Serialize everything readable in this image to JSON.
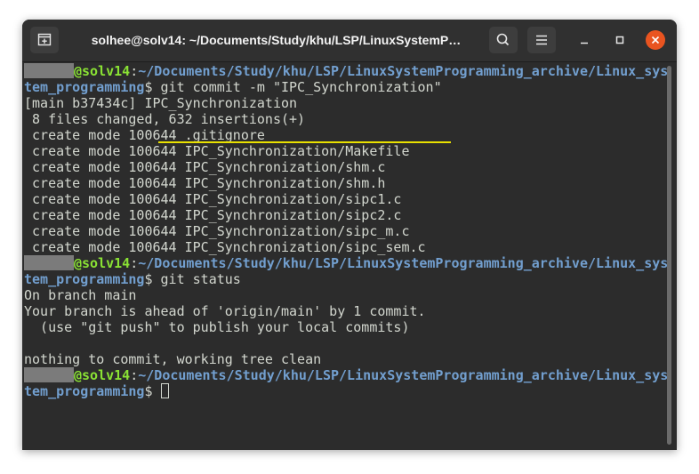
{
  "window": {
    "title": "solhee@solv14: ~/Documents/Study/khu/LSP/LinuxSystemP…",
    "close_color": "#e95420"
  },
  "colors": {
    "background": "#2c2c2c",
    "prompt_user": "#8ae234",
    "prompt_path": "#729fcf",
    "text": "#d3d7cf",
    "highlight_underline": "#e9e100"
  },
  "icons": {
    "new_tab": "new-tab-icon",
    "search": "search-icon",
    "menu": "hamburger-menu-icon",
    "minimize": "minimize-icon",
    "maximize": "maximize-icon",
    "close": "close-icon"
  },
  "prompt": {
    "host": "@solv14",
    "colon": ":",
    "path_line1": "~/Documents/Study/khu/LSP/LinuxSystemProgramming_archive/Linux_sys",
    "path_line2": "tem_programming",
    "dollar": "$"
  },
  "commands": {
    "commit": " git commit -m \"IPC_Synchronization\"",
    "status": " git status",
    "empty": " "
  },
  "output_commit": [
    "[main b37434c] IPC_Synchronization",
    " 8 files changed, 632 insertions(+)",
    " create mode 100644 .gitignore",
    " create mode 100644 IPC_Synchronization/Makefile",
    " create mode 100644 IPC_Synchronization/shm.c",
    " create mode 100644 IPC_Synchronization/shm.h",
    " create mode 100644 IPC_Synchronization/sipc1.c",
    " create mode 100644 IPC_Synchronization/sipc2.c",
    " create mode 100644 IPC_Synchronization/sipc_m.c",
    " create mode 100644 IPC_Synchronization/sipc_sem.c"
  ],
  "output_status": [
    "On branch main",
    "Your branch is ahead of 'origin/main' by 1 commit.",
    "  (use \"git push\" to publish your local commits)",
    "",
    "nothing to commit, working tree clean"
  ]
}
